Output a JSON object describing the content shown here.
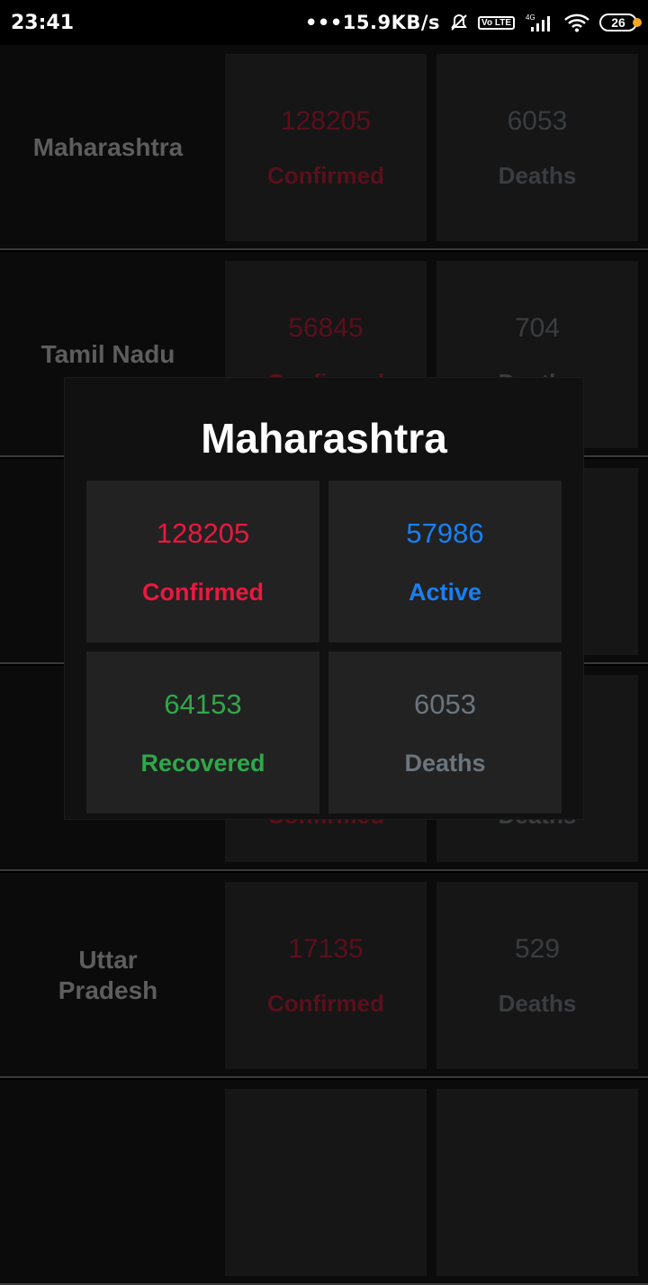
{
  "status_bar": {
    "time": "23:41",
    "net_speed": "•••15.9KB/s",
    "volte_label": "Vo LTE",
    "network": "4G",
    "battery": "26"
  },
  "rows": [
    {
      "name": "Maharashtra",
      "confirmed": "128205",
      "deaths": "6053",
      "confirmed_label": "Confirmed",
      "deaths_label": "Deaths"
    },
    {
      "name": "Tamil Nadu",
      "confirmed": "56845",
      "deaths": "704",
      "confirmed_label": "Confirmed",
      "deaths_label": "Deaths"
    },
    {
      "name": "",
      "confirmed": "",
      "deaths": "",
      "confirmed_label": "",
      "deaths_label": ""
    },
    {
      "name": "",
      "confirmed": "",
      "deaths": "",
      "confirmed_label": "Confirmed",
      "deaths_label": "Deaths"
    },
    {
      "name": "Uttar Pradesh",
      "confirmed": "17135",
      "deaths": "529",
      "confirmed_label": "Confirmed",
      "deaths_label": "Deaths"
    },
    {
      "name": "",
      "confirmed": "",
      "deaths": "",
      "confirmed_label": "",
      "deaths_label": ""
    }
  ],
  "modal": {
    "title": "Maharashtra",
    "confirmed": {
      "value": "128205",
      "label": "Confirmed"
    },
    "active": {
      "value": "57986",
      "label": "Active"
    },
    "recovered": {
      "value": "64153",
      "label": "Recovered"
    },
    "deaths": {
      "value": "6053",
      "label": "Deaths"
    }
  },
  "colors": {
    "confirmed": "#e8193f",
    "active": "#1a7ff0",
    "recovered": "#2fa84a",
    "deaths": "#6c757d"
  }
}
